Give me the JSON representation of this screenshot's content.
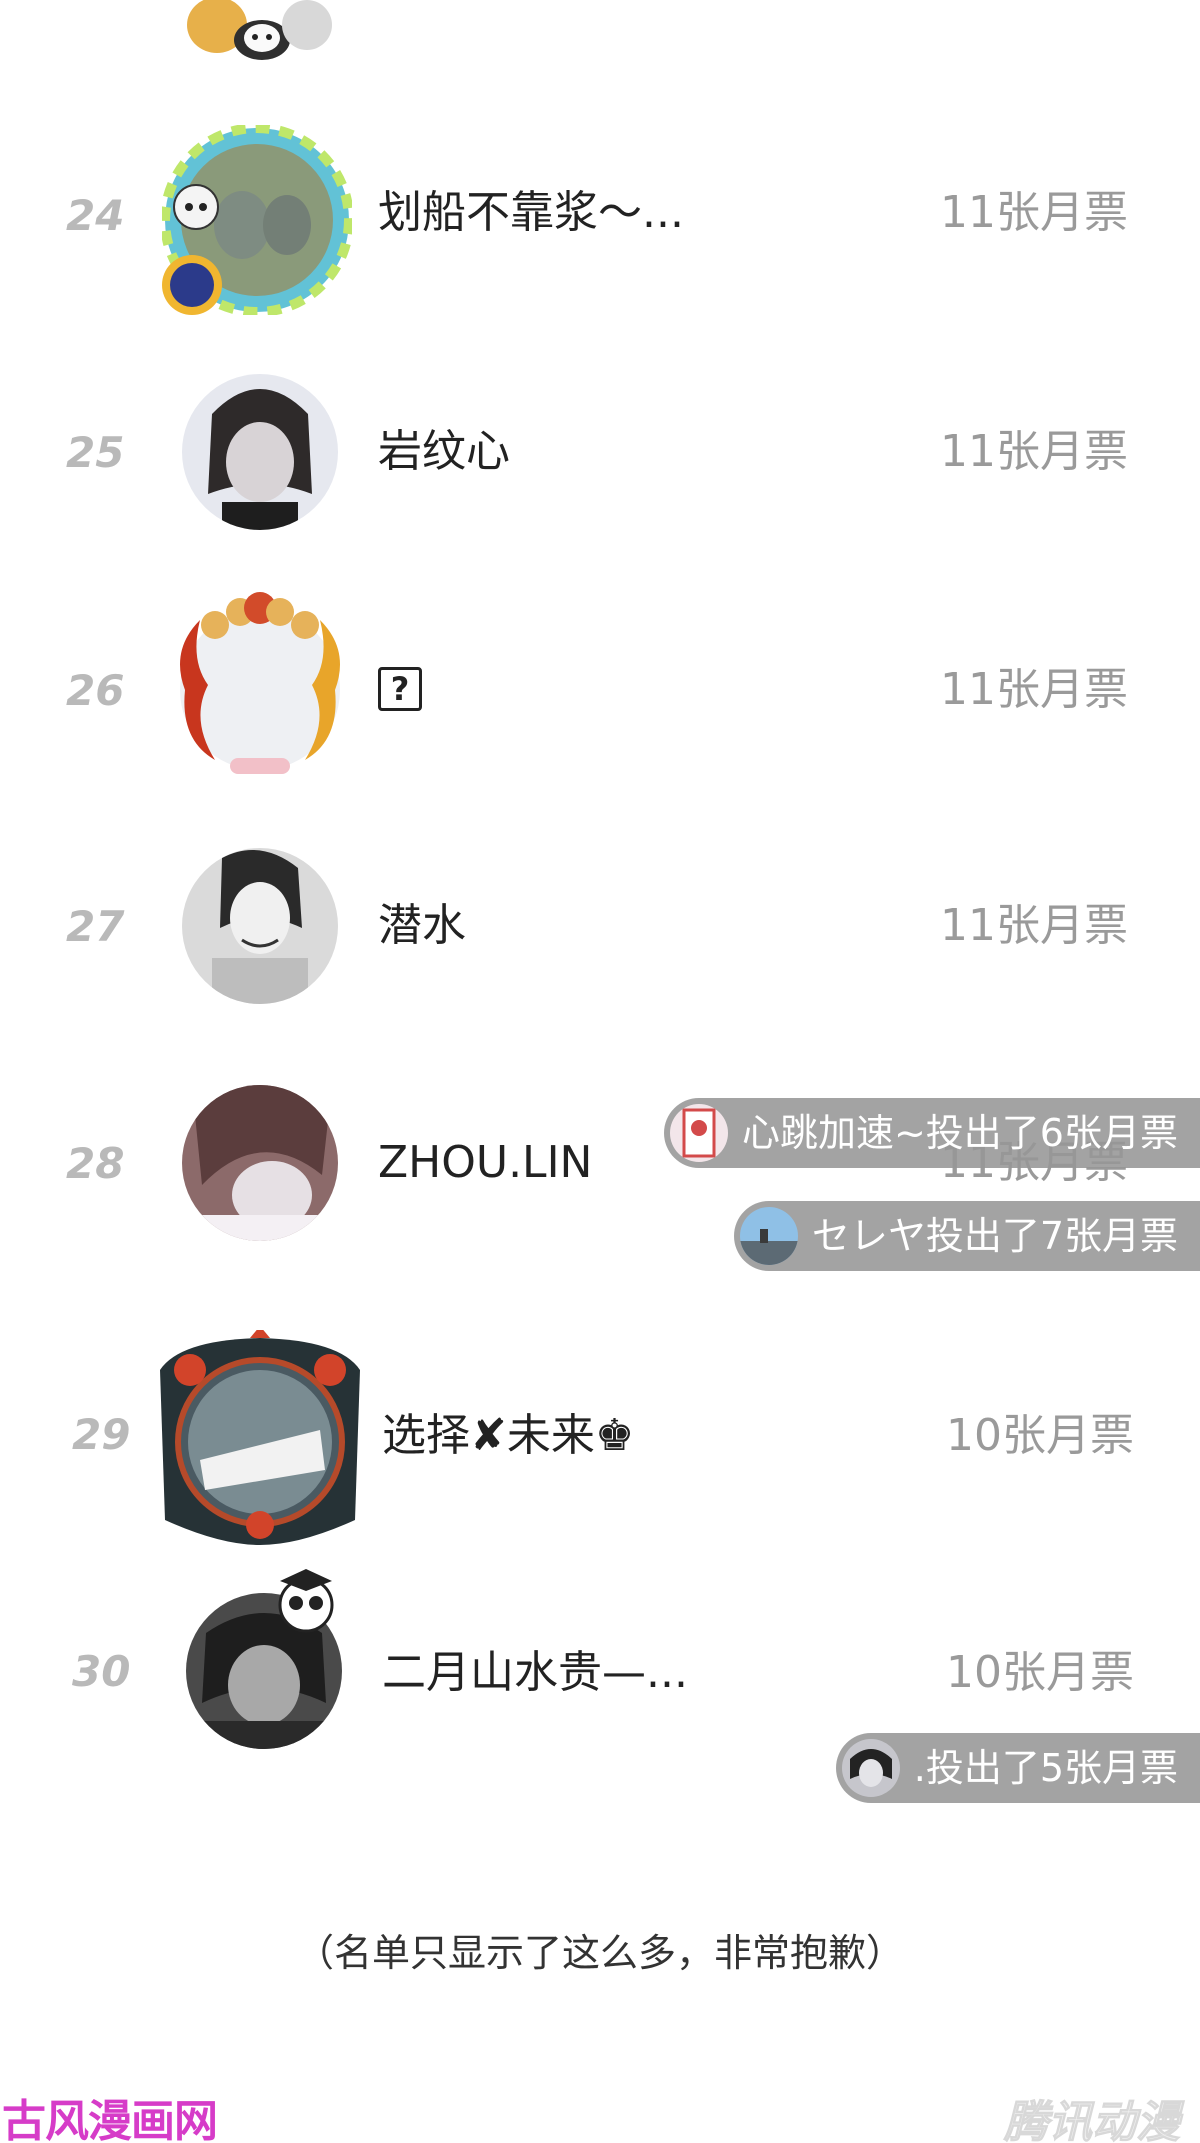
{
  "ranking": [
    {
      "rank": "24",
      "name": "划船不靠浆～...",
      "votes": "11张月票"
    },
    {
      "rank": "25",
      "name": "岩纹心",
      "votes": "11张月票"
    },
    {
      "rank": "26",
      "name": "?",
      "votes": "11张月票"
    },
    {
      "rank": "27",
      "name": "潜水",
      "votes": "11张月票"
    },
    {
      "rank": "28",
      "name": "ZHOU.LIN",
      "votes": "11张月票"
    },
    {
      "rank": "29",
      "name": "选择✘未来♚",
      "votes": "10张月票"
    },
    {
      "rank": "30",
      "name": "二月山水贵—...",
      "votes": "10张月票"
    }
  ],
  "toasts": [
    {
      "text": "心跳加速~投出了6张月票"
    },
    {
      "text": "セレヤ投出了7张月票"
    },
    {
      "text": ".投出了5张月票"
    }
  ],
  "note": "（名单只显示了这么多，非常抱歉）",
  "watermarks": {
    "left": "古风漫画网",
    "right": "腾讯动漫"
  },
  "colors": {
    "rank": "#b9b9b9",
    "votes": "#9a9a9a",
    "toast_bg": "#969696",
    "watermark_left": "#d63cc8"
  }
}
